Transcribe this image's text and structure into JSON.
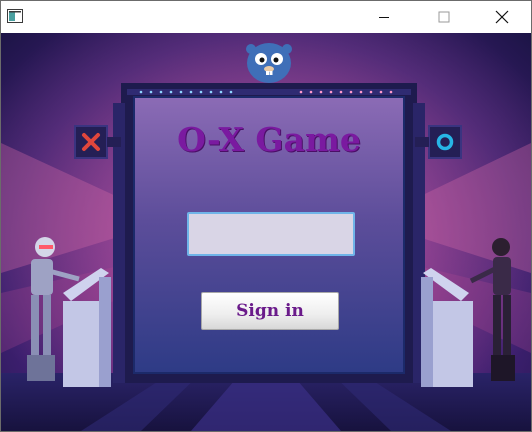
{
  "window": {
    "title": "",
    "controls": {
      "minimize": "minimize-icon",
      "maximize": "maximize-icon",
      "close": "close-icon"
    }
  },
  "game": {
    "title": "O-X Game",
    "name_input": {
      "value": "",
      "placeholder": ""
    },
    "signin_label": "Sign in"
  },
  "colors": {
    "title": "#7a1aa0",
    "button_text": "#6a1a8a",
    "input_border": "#6fb4e8",
    "x_badge": "#e0463c",
    "o_badge": "#27b6e6"
  },
  "icons": {
    "left_badge": "x-mark-icon",
    "right_badge": "o-mark-icon",
    "mascot": "gopher-mascot-icon"
  }
}
